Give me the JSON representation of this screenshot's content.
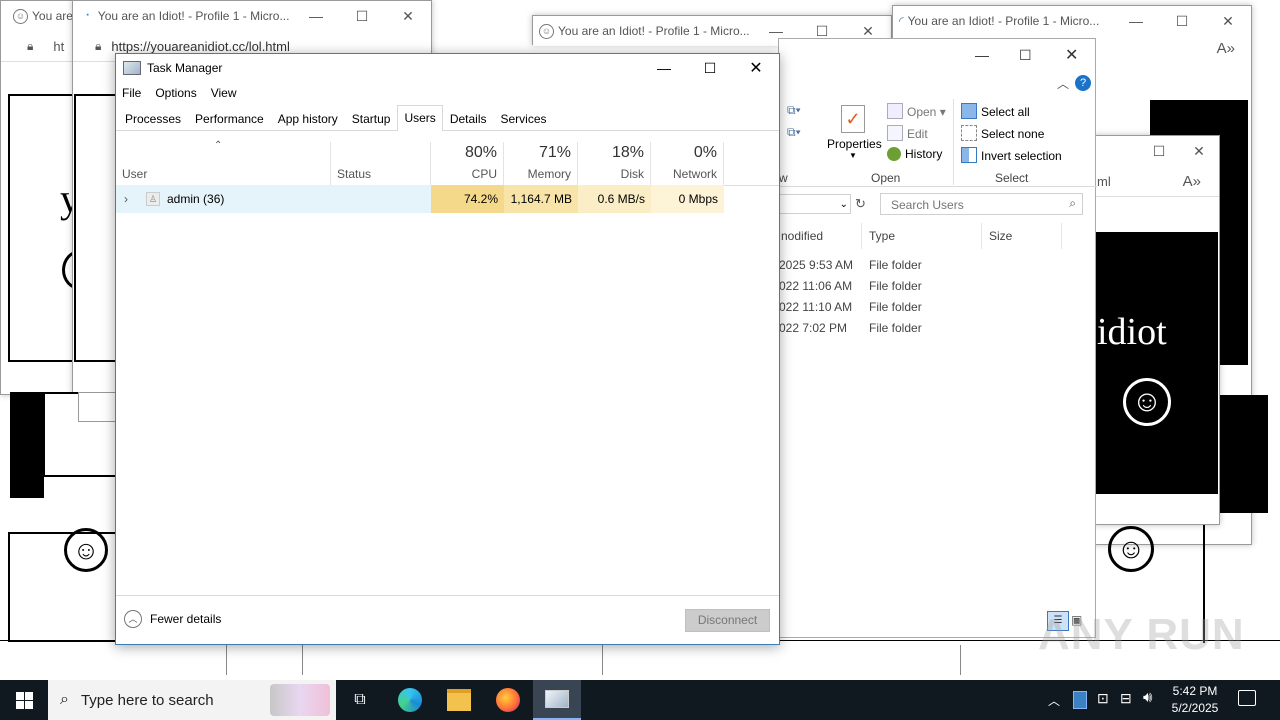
{
  "background_windows": {
    "browser_tab_1": "You are",
    "browser_tab_2": "You are an Idiot! - Profile 1 - Micro...",
    "browser_tab_3": "You are an Idiot! - Profile 1 - Micro...",
    "browser_tab_4": "You are an Idiot! - Profile 1 - Micro...",
    "address_left": "ht",
    "address_main": "https://youareanidiot.cc/lol.html",
    "idiot_text": "idiot",
    "ml_text": "ml",
    "y_text": "y"
  },
  "task_manager": {
    "title": "Task Manager",
    "menu": [
      "File",
      "Options",
      "View"
    ],
    "tabs": [
      "Processes",
      "Performance",
      "App history",
      "Startup",
      "Users",
      "Details",
      "Services"
    ],
    "active_tab": "Users",
    "columns": {
      "user": "User",
      "status": "Status",
      "cpu_pct": "80%",
      "cpu": "CPU",
      "mem_pct": "71%",
      "mem": "Memory",
      "disk_pct": "18%",
      "disk": "Disk",
      "net_pct": "0%",
      "net": "Network"
    },
    "rows": [
      {
        "user": "admin (36)",
        "status": "",
        "cpu": "74.2%",
        "memory": "1,164.7 MB",
        "disk": "0.6 MB/s",
        "network": "0 Mbps"
      }
    ],
    "fewer_details": "Fewer details",
    "disconnect": "Disconnect"
  },
  "explorer": {
    "ribbon": {
      "properties": "Properties",
      "open": "Open",
      "edit": "Edit",
      "history": "History",
      "select_all": "Select all",
      "select_none": "Select none",
      "invert_selection": "Invert selection",
      "group_open": "Open",
      "group_select": "Select",
      "group_w": "w"
    },
    "search_placeholder": "Search Users",
    "headers": {
      "modified": "nodified",
      "type": "Type",
      "size": "Size"
    },
    "files": [
      {
        "modified": "2025 9:53 AM",
        "type": "File folder"
      },
      {
        "modified": "022 11:06 AM",
        "type": "File folder"
      },
      {
        "modified": "022 11:10 AM",
        "type": "File folder"
      },
      {
        "modified": "022 7:02 PM",
        "type": "File folder"
      }
    ]
  },
  "taskbar": {
    "search_placeholder": "Type here to search",
    "time": "5:42 PM",
    "date": "5/2/2025"
  },
  "watermark": "ANY RUN",
  "colors": {
    "cpu_bg": "#f5d98a",
    "mem_bg": "#f8e3a8",
    "disk_bg": "#fbeec6",
    "net_bg": "#fdf4d8",
    "row_sel": "#e5f3fb",
    "taskbar": "#101820"
  }
}
